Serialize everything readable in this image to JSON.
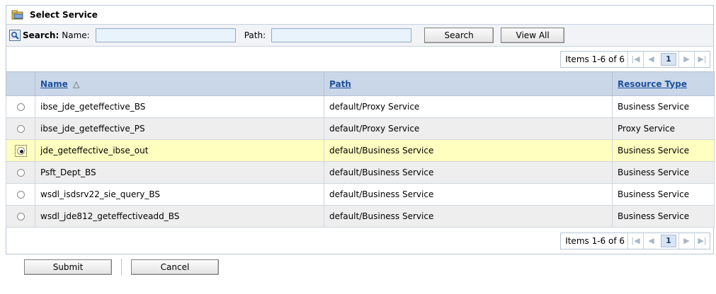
{
  "title": "Select Service",
  "search": {
    "title": "Search:",
    "name_label": "Name:",
    "name_value": "",
    "path_label": "Path:",
    "path_value": "",
    "search_button": "Search",
    "view_all_button": "View All"
  },
  "pager": {
    "items_text": "Items 1-6 of 6",
    "current_page": "1"
  },
  "table": {
    "columns": [
      {
        "label": "Name",
        "sort_indicator": "△"
      },
      {
        "label": "Path"
      },
      {
        "label": "Resource Type"
      }
    ],
    "rows": [
      {
        "selected": false,
        "name": "ibse_jde_geteffective_BS",
        "path": "default/Proxy Service",
        "type": "Business Service"
      },
      {
        "selected": false,
        "name": "ibse_jde_geteffective_PS",
        "path": "default/Proxy Service",
        "type": "Proxy Service"
      },
      {
        "selected": true,
        "name": "jde_geteffective_ibse_out",
        "path": "default/Business Service",
        "type": "Business Service"
      },
      {
        "selected": false,
        "name": "Psft_Dept_BS",
        "path": "default/Business Service",
        "type": "Business Service"
      },
      {
        "selected": false,
        "name": "wsdl_isdsrv22_sie_query_BS",
        "path": "default/Business Service",
        "type": "Business Service"
      },
      {
        "selected": false,
        "name": "wsdl_jde812_geteffectiveadd_BS",
        "path": "default/Business Service",
        "type": "Business Service"
      }
    ]
  },
  "footer": {
    "submit_button": "Submit",
    "cancel_button": "Cancel"
  },
  "colors": {
    "header_bg": "#c9d7e8",
    "selected_row_bg": "#ffffbf",
    "alt_row_bg": "#eeeeee",
    "link": "#1d4f9c"
  }
}
